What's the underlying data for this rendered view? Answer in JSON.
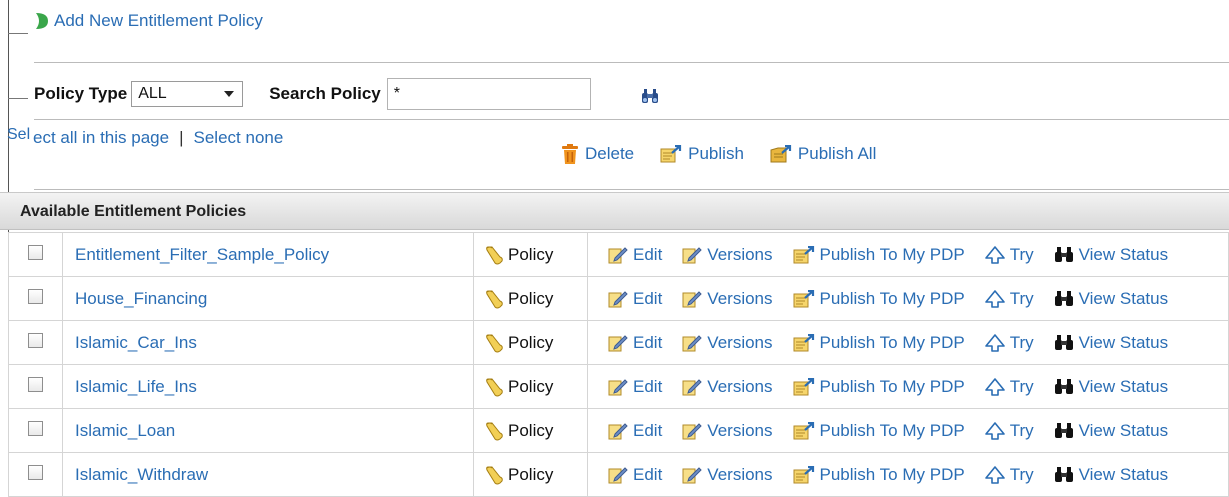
{
  "header": {
    "add_policy_label": "Add New Entitlement Policy"
  },
  "filters": {
    "policy_type_label": "Policy Type",
    "policy_type_value": "ALL",
    "search_label": "Search Policy",
    "search_value": "*"
  },
  "selection": {
    "truncated_label": "Sel",
    "select_all_label": "ect all in this page",
    "separator": "|",
    "select_none_label": "Select none"
  },
  "bulk_actions": {
    "delete_label": "Delete",
    "publish_label": "Publish",
    "publish_all_label": "Publish All"
  },
  "table": {
    "title": "Available Entitlement Policies",
    "type_label": "Policy",
    "ops": {
      "edit": "Edit",
      "versions": "Versions",
      "publish_pdp": "Publish To My PDP",
      "try": "Try",
      "view_status": "View Status"
    },
    "rows": [
      {
        "name": "Entitlement_Filter_Sample_Policy"
      },
      {
        "name": "House_Financing"
      },
      {
        "name": "Islamic_Car_Ins"
      },
      {
        "name": "Islamic_Life_Ins"
      },
      {
        "name": "Islamic_Loan"
      },
      {
        "name": "Islamic_Withdraw"
      }
    ]
  },
  "colors": {
    "link": "#2a6db4",
    "header_bg": "#e3e3e3",
    "add_icon": "#3aa64a",
    "delete_icon": "#e07a10"
  }
}
